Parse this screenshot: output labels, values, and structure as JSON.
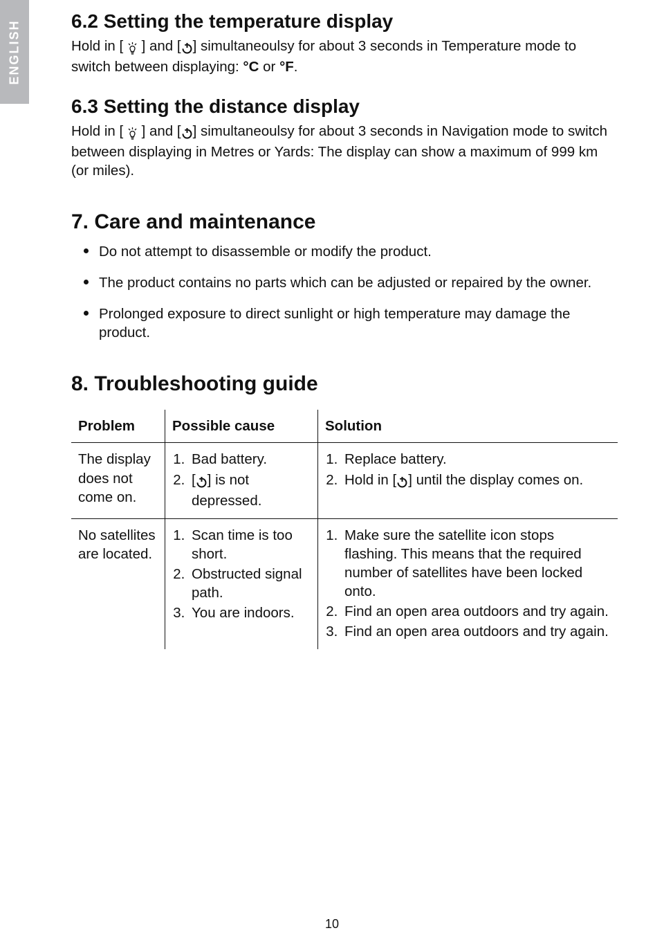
{
  "side_tab": "ENGLISH",
  "section_62": {
    "title": "6.2 Setting the temperature display",
    "body_pre": "Hold in [ ",
    "body_mid1": " ] and [",
    "body_mid2": "] simultaneoulsy for about 3 seconds in Temperature mode to switch between displaying: ",
    "c_label": "°C",
    "or_label": " or ",
    "f_label": "°F",
    "body_end": "."
  },
  "section_63": {
    "title": "6.3 Setting the distance display",
    "body_pre": "Hold in [ ",
    "body_mid1": " ] and [",
    "body_mid2": "] simultaneoulsy for about 3 seconds in Navigation mode to switch between displaying in Metres or Yards: The display can show a maximum of 999 km (or miles)."
  },
  "section_7": {
    "title": "7. Care and maintenance",
    "items": [
      "Do not attempt to disassemble or modify the product.",
      "The product contains no parts which can be adjusted or repaired by the owner.",
      "Prolonged exposure to direct sunlight or high temperature may damage the product."
    ]
  },
  "section_8": {
    "title": "8. Troubleshooting guide",
    "headers": {
      "problem": "Problem",
      "cause": "Possible cause",
      "solution": "Solution"
    },
    "rows": [
      {
        "problem": "The display does not come on.",
        "cause_1": "Bad battery.",
        "cause_2_pre": "[",
        "cause_2_post": "] is not depressed.",
        "solution_1": "Replace battery.",
        "solution_2_pre": "Hold in [",
        "solution_2_post": "] until the display comes on."
      },
      {
        "problem": "No satellites are located.",
        "cause_1": "Scan time is too short.",
        "cause_2": "Obstructed signal path.",
        "cause_3": "You are indoors.",
        "solution_1": "Make sure the satellite icon stops flashing. This means that the required number of satellites have been locked onto.",
        "solution_2": "Find an open area outdoors and try again.",
        "solution_3": "Find an open area outdoors and try again."
      }
    ]
  },
  "page_number": "10"
}
